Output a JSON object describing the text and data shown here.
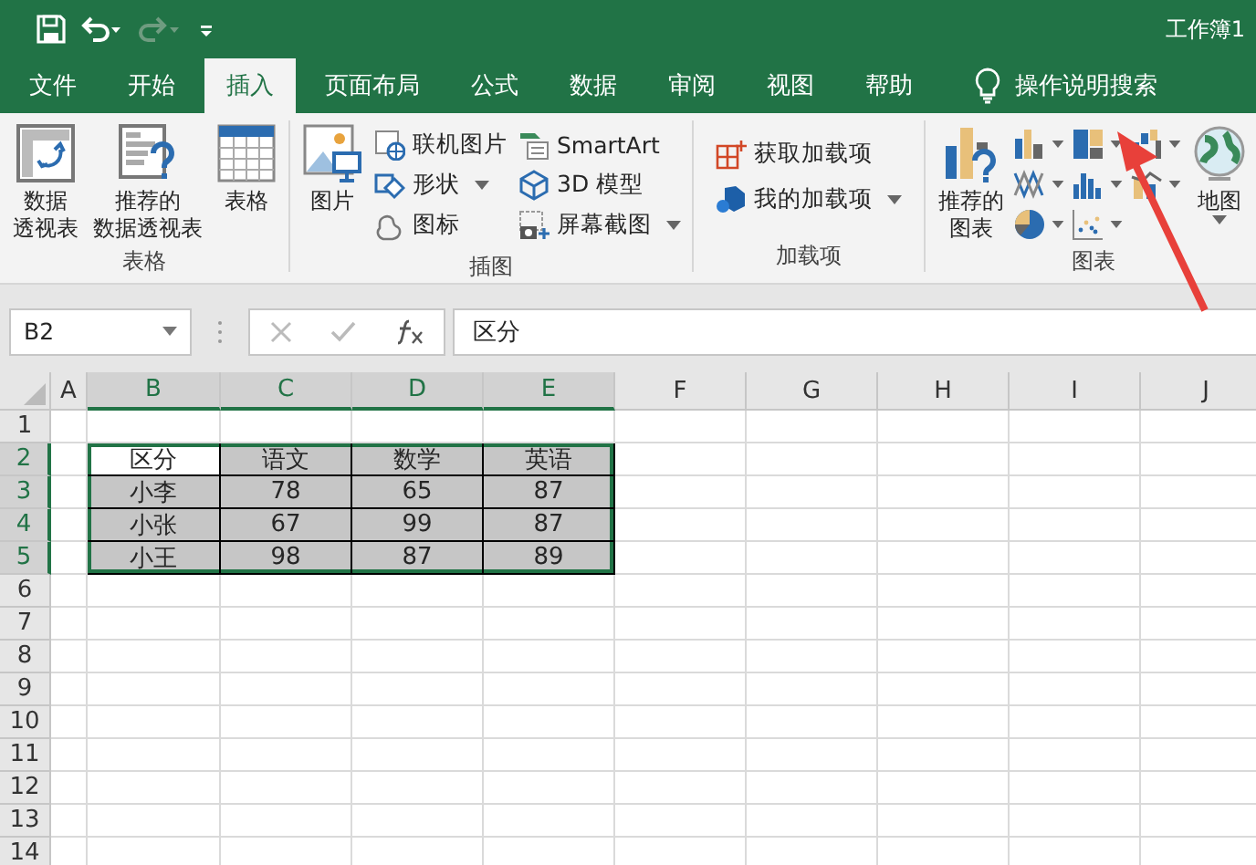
{
  "title_bar": {
    "title": "工作簿1"
  },
  "tabs": [
    {
      "label": "文件",
      "selected": false
    },
    {
      "label": "开始",
      "selected": false
    },
    {
      "label": "插入",
      "selected": true
    },
    {
      "label": "页面布局",
      "selected": false
    },
    {
      "label": "公式",
      "selected": false
    },
    {
      "label": "数据",
      "selected": false
    },
    {
      "label": "审阅",
      "selected": false
    },
    {
      "label": "视图",
      "selected": false
    },
    {
      "label": "帮助",
      "selected": false
    }
  ],
  "tell_me": {
    "label": "操作说明搜索"
  },
  "ribbon": {
    "groups": [
      {
        "label": "表格",
        "items": [
          {
            "kind": "large",
            "label": [
              "数据",
              "透视表"
            ],
            "dropdown": false
          },
          {
            "kind": "large",
            "label": [
              "推荐的",
              "数据透视表"
            ],
            "dropdown": false
          },
          {
            "kind": "large",
            "label": [
              "表格"
            ],
            "dropdown": false
          }
        ]
      },
      {
        "label": "插图",
        "items": [
          {
            "kind": "large",
            "label": [
              "图片"
            ],
            "dropdown": false
          },
          {
            "kind": "stack",
            "items": [
              {
                "label": "联机图片",
                "dropdown": false
              },
              {
                "label": "形状",
                "dropdown": true
              },
              {
                "label": "图标",
                "dropdown": false
              }
            ]
          },
          {
            "kind": "stack",
            "items": [
              {
                "label": "SmartArt",
                "dropdown": false
              },
              {
                "label": "3D 模型",
                "dropdown": false
              },
              {
                "label": "屏幕截图",
                "dropdown": true
              }
            ]
          }
        ]
      },
      {
        "label": "加载项",
        "items": [
          {
            "kind": "stack",
            "items": [
              {
                "label": "获取加载项",
                "dropdown": false
              },
              {
                "label": "我的加载项",
                "dropdown": true
              }
            ]
          }
        ]
      },
      {
        "label": "图表",
        "items": [
          {
            "kind": "large",
            "label": [
              "推荐的",
              "图表"
            ],
            "dropdown": false
          },
          {
            "kind": "chart-icons"
          },
          {
            "kind": "large",
            "label": [
              "地图"
            ],
            "dropdown": true
          }
        ]
      }
    ]
  },
  "formula_bar": {
    "name_box": "B2",
    "formula": "区分"
  },
  "sheet": {
    "columns": [
      {
        "label": "A",
        "selected": false
      },
      {
        "label": "B",
        "selected": true
      },
      {
        "label": "C",
        "selected": true
      },
      {
        "label": "D",
        "selected": true
      },
      {
        "label": "E",
        "selected": true
      },
      {
        "label": "F",
        "selected": false
      },
      {
        "label": "G",
        "selected": false
      },
      {
        "label": "H",
        "selected": false
      },
      {
        "label": "I",
        "selected": false
      },
      {
        "label": "J",
        "selected": false
      }
    ],
    "rows": [
      {
        "label": "1",
        "selected": false
      },
      {
        "label": "2",
        "selected": true,
        "cells": [
          {
            "text": "区分",
            "selected": false,
            "active": true
          },
          {
            "text": "语文",
            "selected": true,
            "active": false
          },
          {
            "text": "数学",
            "selected": true,
            "active": false
          },
          {
            "text": "英语",
            "selected": true,
            "active": false
          }
        ]
      },
      {
        "label": "3",
        "selected": true,
        "cells": [
          {
            "text": "小李",
            "selected": true,
            "active": false
          },
          {
            "text": "78",
            "selected": true,
            "active": false
          },
          {
            "text": "65",
            "selected": true,
            "active": false
          },
          {
            "text": "87",
            "selected": true,
            "active": false
          }
        ]
      },
      {
        "label": "4",
        "selected": true,
        "cells": [
          {
            "text": "小张",
            "selected": true,
            "active": false
          },
          {
            "text": "67",
            "selected": true,
            "active": false
          },
          {
            "text": "99",
            "selected": true,
            "active": false
          },
          {
            "text": "87",
            "selected": true,
            "active": false
          }
        ]
      },
      {
        "label": "5",
        "selected": true,
        "cells": [
          {
            "text": "小王",
            "selected": true,
            "active": false
          },
          {
            "text": "98",
            "selected": true,
            "active": false
          },
          {
            "text": "87",
            "selected": true,
            "active": false
          },
          {
            "text": "89",
            "selected": true,
            "active": false
          }
        ]
      },
      {
        "label": "6",
        "selected": false
      },
      {
        "label": "7",
        "selected": false
      },
      {
        "label": "8",
        "selected": false
      },
      {
        "label": "9",
        "selected": false
      },
      {
        "label": "10",
        "selected": false
      },
      {
        "label": "11",
        "selected": false
      },
      {
        "label": "12",
        "selected": false
      },
      {
        "label": "13",
        "selected": false
      },
      {
        "label": "14",
        "selected": false
      }
    ]
  }
}
